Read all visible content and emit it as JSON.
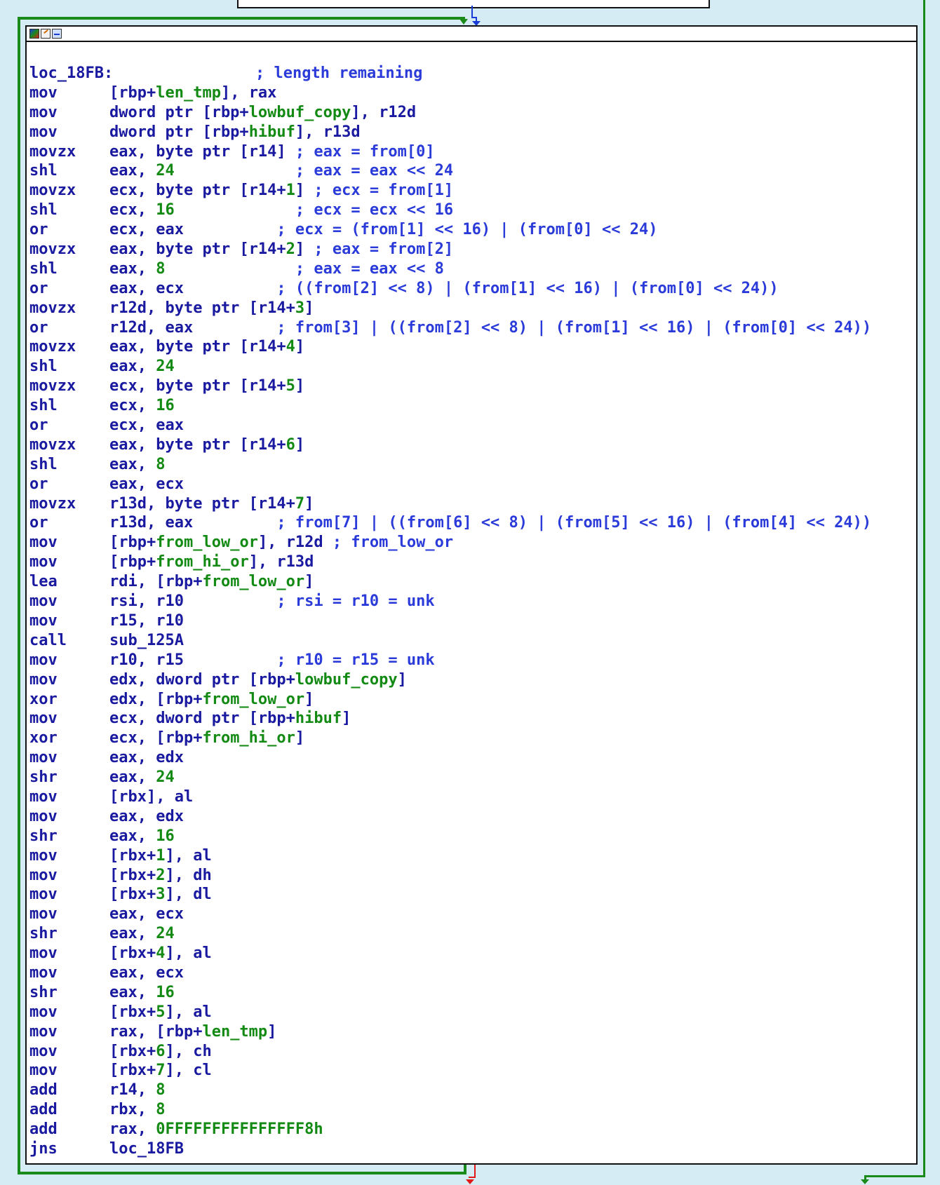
{
  "window": {
    "toolbar_icons": [
      "color-palette-icon",
      "edit-node-icon",
      "graph-overview-icon"
    ],
    "colors": {
      "background": "#d6ecf5",
      "true_edge": "#1a8a1a",
      "normal_edge": "#1a3cd6",
      "false_edge": "#e01818",
      "mnemonic": "#1a1aa0",
      "immediate_and_variable": "#138a13",
      "comment": "#2b3bd9"
    }
  },
  "block": {
    "lines": [
      {
        "label": "loc_18FB:",
        "comment": "; length remaining"
      },
      {
        "mnem": "mov",
        "ops": [
          [
            "[rbp+",
            "p"
          ],
          [
            "len_tmp",
            "v"
          ],
          [
            "], rax",
            "p"
          ]
        ]
      },
      {
        "mnem": "mov",
        "ops": [
          [
            "dword ptr [rbp+",
            "p"
          ],
          [
            "lowbuf_copy",
            "v"
          ],
          [
            "], r12d",
            "p"
          ]
        ]
      },
      {
        "mnem": "mov",
        "ops": [
          [
            "dword ptr [rbp+",
            "p"
          ],
          [
            "hibuf",
            "v"
          ],
          [
            "], r13d",
            "p"
          ]
        ]
      },
      {
        "mnem": "movzx",
        "ops": [
          [
            "eax, byte ptr [r14] ",
            "p"
          ],
          [
            "; eax = from[0]",
            "c"
          ]
        ]
      },
      {
        "mnem": "shl",
        "ops": [
          [
            "eax, ",
            "p"
          ],
          [
            "24",
            "n"
          ],
          [
            "             ",
            "p"
          ],
          [
            "; eax = eax << 24",
            "c"
          ]
        ]
      },
      {
        "mnem": "movzx",
        "ops": [
          [
            "ecx, byte ptr [r14+",
            "p"
          ],
          [
            "1",
            "n"
          ],
          [
            "] ",
            "p"
          ],
          [
            "; ecx = from[1]",
            "c"
          ]
        ]
      },
      {
        "mnem": "shl",
        "ops": [
          [
            "ecx, ",
            "p"
          ],
          [
            "16",
            "n"
          ],
          [
            "             ",
            "p"
          ],
          [
            "; ecx = ecx << 16",
            "c"
          ]
        ]
      },
      {
        "mnem": "or",
        "ops": [
          [
            "ecx, eax          ",
            "p"
          ],
          [
            "; ecx = (from[1] << 16) | (from[0] << 24)",
            "c"
          ]
        ]
      },
      {
        "mnem": "movzx",
        "ops": [
          [
            "eax, byte ptr [r14+",
            "p"
          ],
          [
            "2",
            "n"
          ],
          [
            "] ",
            "p"
          ],
          [
            "; eax = from[2]",
            "c"
          ]
        ]
      },
      {
        "mnem": "shl",
        "ops": [
          [
            "eax, ",
            "p"
          ],
          [
            "8",
            "n"
          ],
          [
            "              ",
            "p"
          ],
          [
            "; eax = eax << 8",
            "c"
          ]
        ]
      },
      {
        "mnem": "or",
        "ops": [
          [
            "eax, ecx          ",
            "p"
          ],
          [
            "; ((from[2] << 8) | (from[1] << 16) | (from[0] << 24))",
            "c"
          ]
        ]
      },
      {
        "mnem": "movzx",
        "ops": [
          [
            "r12d, byte ptr [r14+",
            "p"
          ],
          [
            "3",
            "n"
          ],
          [
            "]",
            "p"
          ]
        ]
      },
      {
        "mnem": "or",
        "ops": [
          [
            "r12d, eax         ",
            "p"
          ],
          [
            "; from[3] | ((from[2] << 8) | (from[1] << 16) | (from[0] << 24))",
            "c"
          ]
        ]
      },
      {
        "mnem": "movzx",
        "ops": [
          [
            "eax, byte ptr [r14+",
            "p"
          ],
          [
            "4",
            "n"
          ],
          [
            "]",
            "p"
          ]
        ]
      },
      {
        "mnem": "shl",
        "ops": [
          [
            "eax, ",
            "p"
          ],
          [
            "24",
            "n"
          ]
        ]
      },
      {
        "mnem": "movzx",
        "ops": [
          [
            "ecx, byte ptr [r14+",
            "p"
          ],
          [
            "5",
            "n"
          ],
          [
            "]",
            "p"
          ]
        ]
      },
      {
        "mnem": "shl",
        "ops": [
          [
            "ecx, ",
            "p"
          ],
          [
            "16",
            "n"
          ]
        ]
      },
      {
        "mnem": "or",
        "ops": [
          [
            "ecx, eax",
            "p"
          ]
        ]
      },
      {
        "mnem": "movzx",
        "ops": [
          [
            "eax, byte ptr [r14+",
            "p"
          ],
          [
            "6",
            "n"
          ],
          [
            "]",
            "p"
          ]
        ]
      },
      {
        "mnem": "shl",
        "ops": [
          [
            "eax, ",
            "p"
          ],
          [
            "8",
            "n"
          ]
        ]
      },
      {
        "mnem": "or",
        "ops": [
          [
            "eax, ecx",
            "p"
          ]
        ]
      },
      {
        "mnem": "movzx",
        "ops": [
          [
            "r13d, byte ptr [r14+",
            "p"
          ],
          [
            "7",
            "n"
          ],
          [
            "]",
            "p"
          ]
        ]
      },
      {
        "mnem": "or",
        "ops": [
          [
            "r13d, eax         ",
            "p"
          ],
          [
            "; from[7] | ((from[6] << 8) | (from[5] << 16) | (from[4] << 24))",
            "c"
          ]
        ]
      },
      {
        "mnem": "mov",
        "ops": [
          [
            "[rbp+",
            "p"
          ],
          [
            "from_low_or",
            "v"
          ],
          [
            "], r12d ",
            "p"
          ],
          [
            "; from_low_or",
            "c"
          ]
        ]
      },
      {
        "mnem": "mov",
        "ops": [
          [
            "[rbp+",
            "p"
          ],
          [
            "from_hi_or",
            "v"
          ],
          [
            "], r13d",
            "p"
          ]
        ]
      },
      {
        "mnem": "lea",
        "ops": [
          [
            "rdi, [rbp+",
            "p"
          ],
          [
            "from_low_or",
            "v"
          ],
          [
            "]",
            "p"
          ]
        ]
      },
      {
        "mnem": "mov",
        "ops": [
          [
            "rsi, r10          ",
            "p"
          ],
          [
            "; rsi = r10 = unk",
            "c"
          ]
        ]
      },
      {
        "mnem": "mov",
        "ops": [
          [
            "r15, r10",
            "p"
          ]
        ]
      },
      {
        "mnem": "call",
        "ops": [
          [
            "sub_125A",
            "p"
          ]
        ]
      },
      {
        "mnem": "mov",
        "ops": [
          [
            "r10, r15          ",
            "p"
          ],
          [
            "; r10 = r15 = unk",
            "c"
          ]
        ]
      },
      {
        "mnem": "mov",
        "ops": [
          [
            "edx, dword ptr [rbp+",
            "p"
          ],
          [
            "lowbuf_copy",
            "v"
          ],
          [
            "]",
            "p"
          ]
        ]
      },
      {
        "mnem": "xor",
        "ops": [
          [
            "edx, [rbp+",
            "p"
          ],
          [
            "from_low_or",
            "v"
          ],
          [
            "]",
            "p"
          ]
        ]
      },
      {
        "mnem": "mov",
        "ops": [
          [
            "ecx, dword ptr [rbp+",
            "p"
          ],
          [
            "hibuf",
            "v"
          ],
          [
            "]",
            "p"
          ]
        ]
      },
      {
        "mnem": "xor",
        "ops": [
          [
            "ecx, [rbp+",
            "p"
          ],
          [
            "from_hi_or",
            "v"
          ],
          [
            "]",
            "p"
          ]
        ]
      },
      {
        "mnem": "mov",
        "ops": [
          [
            "eax, edx",
            "p"
          ]
        ]
      },
      {
        "mnem": "shr",
        "ops": [
          [
            "eax, ",
            "p"
          ],
          [
            "24",
            "n"
          ]
        ]
      },
      {
        "mnem": "mov",
        "ops": [
          [
            "[rbx], al",
            "p"
          ]
        ]
      },
      {
        "mnem": "mov",
        "ops": [
          [
            "eax, edx",
            "p"
          ]
        ]
      },
      {
        "mnem": "shr",
        "ops": [
          [
            "eax, ",
            "p"
          ],
          [
            "16",
            "n"
          ]
        ]
      },
      {
        "mnem": "mov",
        "ops": [
          [
            "[rbx+",
            "p"
          ],
          [
            "1",
            "n"
          ],
          [
            "], al",
            "p"
          ]
        ]
      },
      {
        "mnem": "mov",
        "ops": [
          [
            "[rbx+",
            "p"
          ],
          [
            "2",
            "n"
          ],
          [
            "], dh",
            "p"
          ]
        ]
      },
      {
        "mnem": "mov",
        "ops": [
          [
            "[rbx+",
            "p"
          ],
          [
            "3",
            "n"
          ],
          [
            "], dl",
            "p"
          ]
        ]
      },
      {
        "mnem": "mov",
        "ops": [
          [
            "eax, ecx",
            "p"
          ]
        ]
      },
      {
        "mnem": "shr",
        "ops": [
          [
            "eax, ",
            "p"
          ],
          [
            "24",
            "n"
          ]
        ]
      },
      {
        "mnem": "mov",
        "ops": [
          [
            "[rbx+",
            "p"
          ],
          [
            "4",
            "n"
          ],
          [
            "], al",
            "p"
          ]
        ]
      },
      {
        "mnem": "mov",
        "ops": [
          [
            "eax, ecx",
            "p"
          ]
        ]
      },
      {
        "mnem": "shr",
        "ops": [
          [
            "eax, ",
            "p"
          ],
          [
            "16",
            "n"
          ]
        ]
      },
      {
        "mnem": "mov",
        "ops": [
          [
            "[rbx+",
            "p"
          ],
          [
            "5",
            "n"
          ],
          [
            "], al",
            "p"
          ]
        ]
      },
      {
        "mnem": "mov",
        "ops": [
          [
            "rax, [rbp+",
            "p"
          ],
          [
            "len_tmp",
            "v"
          ],
          [
            "]",
            "p"
          ]
        ]
      },
      {
        "mnem": "mov",
        "ops": [
          [
            "[rbx+",
            "p"
          ],
          [
            "6",
            "n"
          ],
          [
            "], ch",
            "p"
          ]
        ]
      },
      {
        "mnem": "mov",
        "ops": [
          [
            "[rbx+",
            "p"
          ],
          [
            "7",
            "n"
          ],
          [
            "], cl",
            "p"
          ]
        ]
      },
      {
        "mnem": "add",
        "ops": [
          [
            "r14, ",
            "p"
          ],
          [
            "8",
            "n"
          ]
        ]
      },
      {
        "mnem": "add",
        "ops": [
          [
            "rbx, ",
            "p"
          ],
          [
            "8",
            "n"
          ]
        ]
      },
      {
        "mnem": "add",
        "ops": [
          [
            "rax, ",
            "p"
          ],
          [
            "0FFFFFFFFFFFFFFF8h",
            "n"
          ]
        ]
      },
      {
        "mnem": "jns",
        "ops": [
          [
            "loc_18FB",
            "p"
          ]
        ]
      }
    ]
  }
}
